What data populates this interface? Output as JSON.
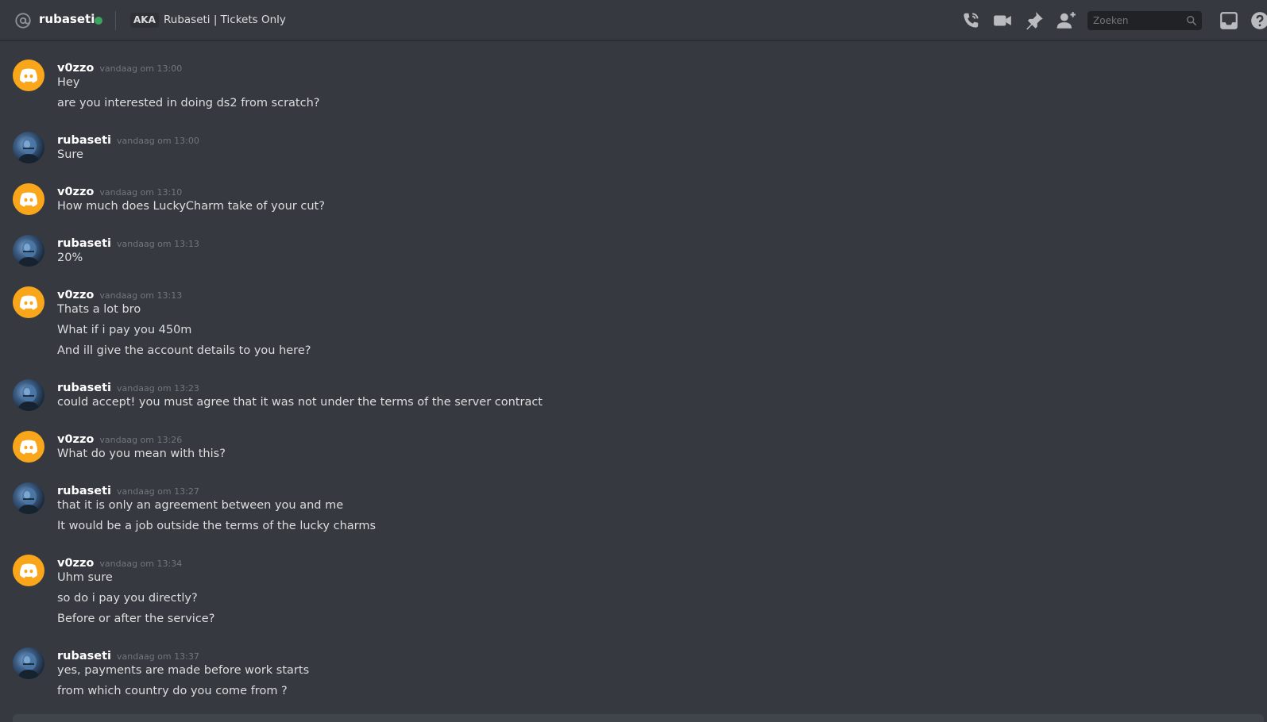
{
  "header": {
    "username": "rubaseti",
    "aka_label": "AKA",
    "aka_text": "Rubaseti | Tickets Only",
    "search_placeholder": "Zoeken",
    "status_color": "#3ba55d",
    "icons": [
      "at-icon",
      "phone-call-icon",
      "video-call-icon",
      "pin-icon",
      "add-friend-icon",
      "search-icon",
      "inbox-icon",
      "help-icon"
    ]
  },
  "messages": [
    {
      "author": "v0zzo",
      "time": "vandaag om 13:00",
      "avatar": "discord-logo",
      "lines": [
        "Hey",
        "are you interested in doing ds2 from scratch?"
      ]
    },
    {
      "author": "rubaseti",
      "time": "vandaag om 13:00",
      "avatar": "user-photo",
      "lines": [
        "Sure"
      ]
    },
    {
      "author": "v0zzo",
      "time": "vandaag om 13:10",
      "avatar": "discord-logo",
      "lines": [
        "How much does LuckyCharm take of your cut?"
      ]
    },
    {
      "author": "rubaseti",
      "time": "vandaag om 13:13",
      "avatar": "user-photo",
      "lines": [
        "20%"
      ]
    },
    {
      "author": "v0zzo",
      "time": "vandaag om 13:13",
      "avatar": "discord-logo",
      "lines": [
        "Thats a lot bro",
        "What if i pay you 450m",
        "And ill give the account details to you here?"
      ]
    },
    {
      "author": "rubaseti",
      "time": "vandaag om 13:23",
      "avatar": "user-photo",
      "lines": [
        "could accept! you must agree that it was not under the terms of the server contract"
      ]
    },
    {
      "author": "v0zzo",
      "time": "vandaag om 13:26",
      "avatar": "discord-logo",
      "lines": [
        "What do you mean with this?"
      ]
    },
    {
      "author": "rubaseti",
      "time": "vandaag om 13:27",
      "avatar": "user-photo",
      "lines": [
        "that it is only an agreement between you and me",
        "It would be a job outside the terms of the lucky charms"
      ]
    },
    {
      "author": "v0zzo",
      "time": "vandaag om 13:34",
      "avatar": "discord-logo",
      "lines": [
        "Uhm sure",
        "so do i pay you directly?",
        "Before or after the service?"
      ]
    },
    {
      "author": "rubaseti",
      "time": "vandaag om 13:37",
      "avatar": "user-photo",
      "lines": [
        "yes, payments are made before work starts",
        "from which country do you come from ?"
      ]
    }
  ]
}
